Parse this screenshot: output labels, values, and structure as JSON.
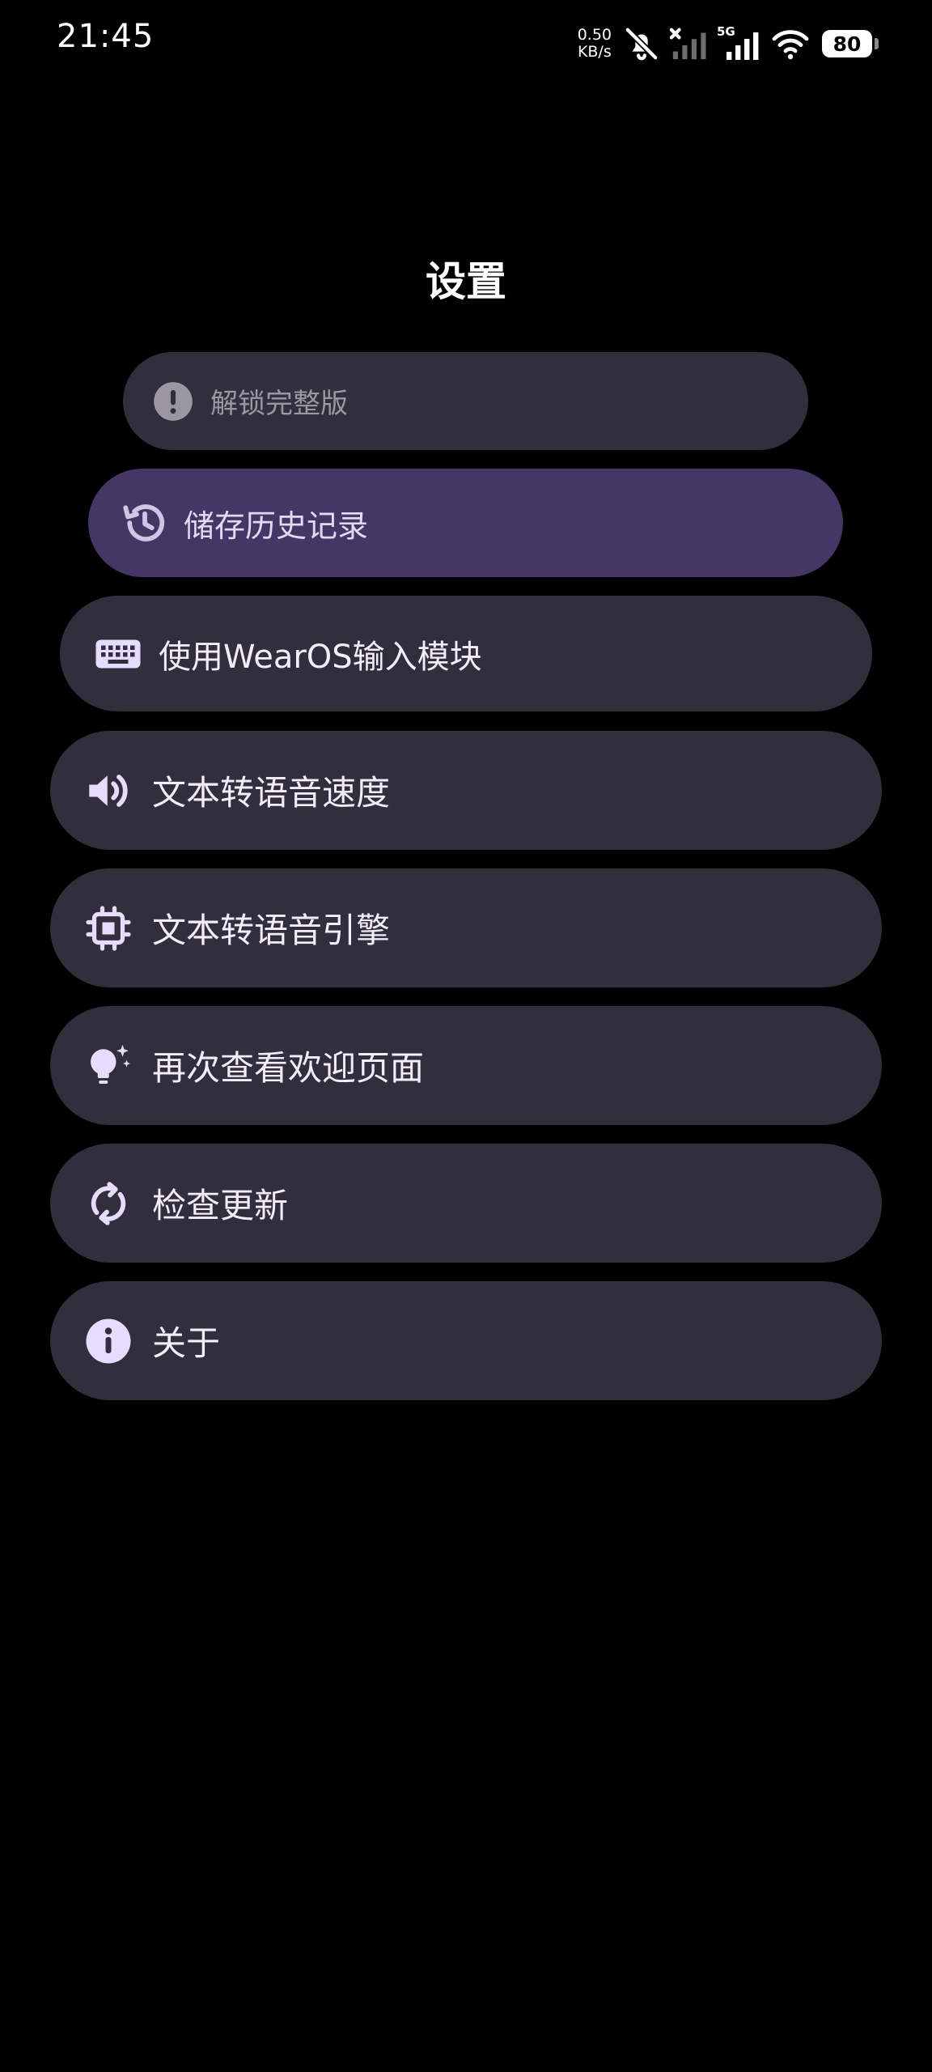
{
  "status_bar": {
    "time": "21:45",
    "net_speed_value": "0.50",
    "net_speed_unit": "KB/s",
    "network_type": "5G",
    "battery_level": "80"
  },
  "page": {
    "title": "设置"
  },
  "settings": {
    "unlock_label": "解锁完整版",
    "history_label": "储存历史记录",
    "wearos_label": "使用WearOS输入模块",
    "tts_speed_label": "文本转语音速度",
    "tts_engine_label": "文本转语音引擎",
    "welcome_label": "再次查看欢迎页面",
    "update_label": "检查更新",
    "about_label": "关于"
  },
  "colors": {
    "background": "#000000",
    "pill": "#322f3d",
    "pill_active": "#443766",
    "accent_icon": "#e7dcff"
  },
  "icons": {
    "unlock": "alert-circle-icon",
    "history": "history-icon",
    "wearos": "keyboard-icon",
    "tts_speed": "volume-icon",
    "tts_engine": "chip-icon",
    "welcome": "lightbulb-icon",
    "update": "refresh-icon",
    "about": "info-icon"
  }
}
